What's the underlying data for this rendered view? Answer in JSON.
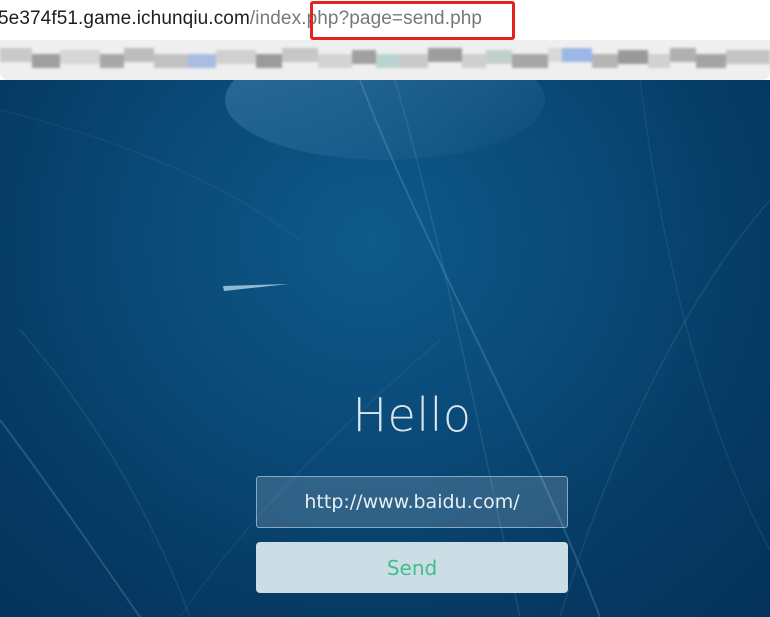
{
  "browser": {
    "url_host": "5e374f51.game.ichunqiu.com",
    "url_path": "/index.php?page=send.php",
    "highlight_color": "#e8211e"
  },
  "bookmarks_bar": {
    "note_obscured": true
  },
  "page": {
    "heading": "Hello",
    "url_input_value": "http://www.baidu.com/",
    "send_label": "Send",
    "background_color": "#0a4a78",
    "button_text_color": "#3fbf8e"
  }
}
